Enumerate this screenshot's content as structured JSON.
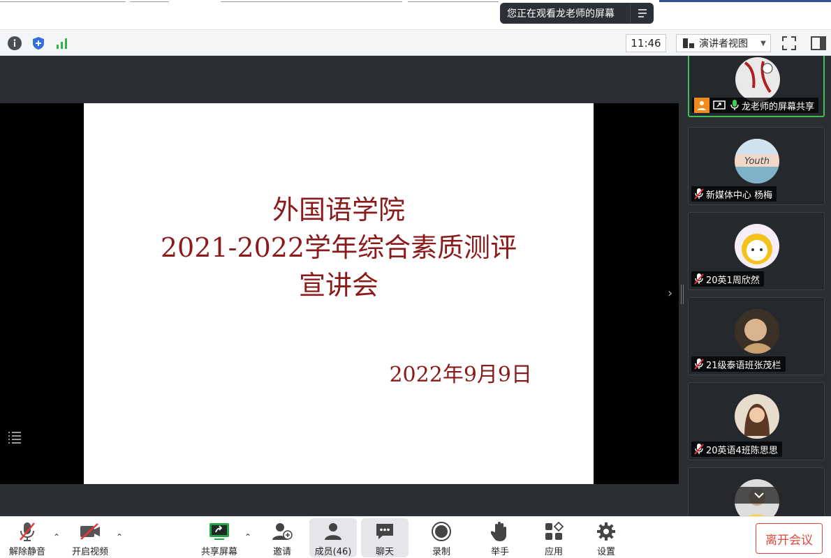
{
  "banner": {
    "text": "您正在观看龙老师的屏幕"
  },
  "infobar": {
    "time": "11:46",
    "view_label": "演讲者视图"
  },
  "slide": {
    "line1": "外国语学院",
    "line2": "2021-2022学年综合素质测评",
    "line3": "宣讲会",
    "date": "2022年9月9日"
  },
  "participants": [
    {
      "name": "龙老师的屏幕共享",
      "active": true
    },
    {
      "name": "新媒体中心 杨梅"
    },
    {
      "name": "20英1周欣然"
    },
    {
      "name": "21级泰语班张茂栏"
    },
    {
      "name": "20英语4班陈思思"
    }
  ],
  "toolbar": {
    "unmute": "解除静音",
    "video": "开启视频",
    "share": "共享屏幕",
    "invite": "邀请",
    "members": "成员(46)",
    "chat": "聊天",
    "record": "录制",
    "raise_hand": "举手",
    "apps": "应用",
    "settings": "设置",
    "leave": "离开会议"
  },
  "colors": {
    "accent_red": "#8b1a1a",
    "leave_red": "#e0483e",
    "active_green": "#3fbf5a"
  }
}
